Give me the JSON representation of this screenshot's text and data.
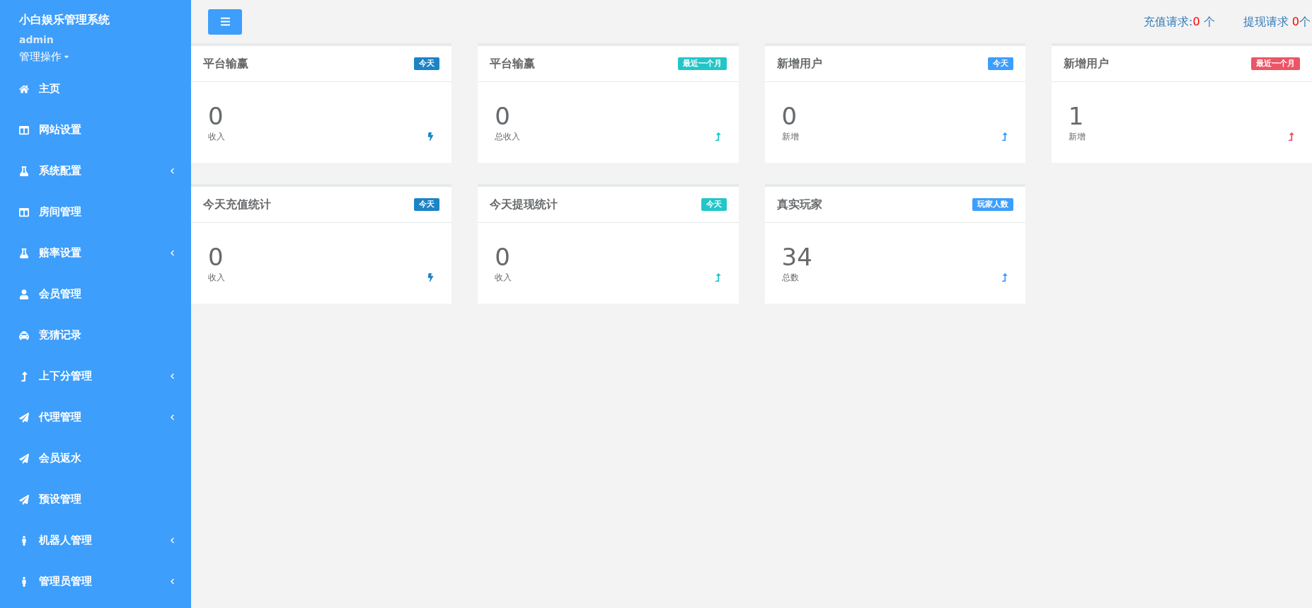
{
  "sidebar": {
    "title": "小白娱乐管理系统",
    "user": "admin",
    "user_menu": "管理操作",
    "items": [
      {
        "label": "主页",
        "kind": "home",
        "expandable": false
      },
      {
        "label": "网站设置",
        "kind": "columns",
        "expandable": false
      },
      {
        "label": "系统配置",
        "kind": "flask",
        "expandable": true
      },
      {
        "label": "房间管理",
        "kind": "columns",
        "expandable": false
      },
      {
        "label": "赔率设置",
        "kind": "flask",
        "expandable": true
      },
      {
        "label": "会员管理",
        "kind": "user",
        "expandable": false
      },
      {
        "label": "竞猜记录",
        "kind": "taxi",
        "expandable": false
      },
      {
        "label": "上下分管理",
        "kind": "transfer",
        "expandable": true
      },
      {
        "label": "代理管理",
        "kind": "plane",
        "expandable": true
      },
      {
        "label": "会员返水",
        "kind": "plane",
        "expandable": false
      },
      {
        "label": "预设管理",
        "kind": "plane",
        "expandable": false
      },
      {
        "label": "机器人管理",
        "kind": "male",
        "expandable": true
      },
      {
        "label": "管理员管理",
        "kind": "male",
        "expandable": true
      }
    ]
  },
  "top_bar": {
    "requests": [
      {
        "label": "充值请求:",
        "count": "0",
        "unit": " 个"
      },
      {
        "label": "提现请求 ",
        "count": "0",
        "unit": "个"
      }
    ]
  },
  "cards": [
    {
      "title": "平台输赢",
      "badge": "今天",
      "color": "#1c84c6",
      "value": "0",
      "caption": "收入",
      "kind": "flash"
    },
    {
      "title": "平台输赢",
      "badge": "最近一个月",
      "color": "#23c6c8",
      "value": "0",
      "caption": "总收入",
      "kind": "trend"
    },
    {
      "title": "新增用户",
      "badge": "今天",
      "color": "#3d9efc",
      "value": "0",
      "caption": "新增",
      "kind": "trend"
    },
    {
      "title": "新增用户",
      "badge": "最近一个月",
      "color": "#ed5565",
      "value": "1",
      "caption": "新增",
      "kind": "trend"
    },
    {
      "title": "今天充值统计",
      "badge": "今天",
      "color": "#1c84c6",
      "value": "0",
      "caption": "收入",
      "kind": "flash"
    },
    {
      "title": "今天提现统计",
      "badge": "今天",
      "color": "#23c6c8",
      "value": "0",
      "caption": "收入",
      "kind": "trend"
    },
    {
      "title": "真实玩家",
      "badge": "玩家人数",
      "color": "#3d9efc",
      "value": "34",
      "caption": "总数",
      "kind": "trend"
    }
  ]
}
